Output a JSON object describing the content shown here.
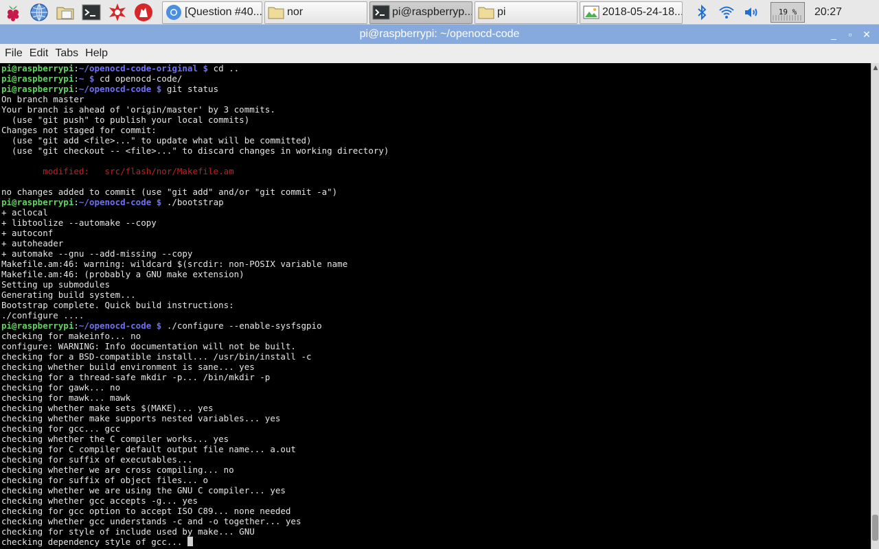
{
  "panel": {
    "tasks": [
      {
        "label": "[Question #40...",
        "icon": "chromium-icon"
      },
      {
        "label": "nor",
        "icon": "folder-icon"
      },
      {
        "label": "pi@raspberryp...",
        "icon": "terminal-icon"
      },
      {
        "label": "pi",
        "icon": "folder-icon"
      },
      {
        "label": "2018-05-24-18...",
        "icon": "image-icon"
      }
    ],
    "cpu": "19 %",
    "clock": "20:27"
  },
  "window": {
    "title": "pi@raspberrypi: ~/openocd-code",
    "minimize": "_",
    "maximize": "▫",
    "close": "✕"
  },
  "menu": [
    "File",
    "Edit",
    "Tabs",
    "Help"
  ],
  "colors": {
    "prompt_user": "#5fd65f",
    "prompt_path": "#6f6ff8",
    "modified": "#c02020",
    "titlebar": "#87aade"
  },
  "terminal": {
    "lines": [
      {
        "user": "pi@raspberrypi",
        "path": "~/openocd-code-original $",
        "cmd": " cd .."
      },
      {
        "user": "pi@raspberrypi",
        "path": "~ $",
        "cmd": " cd openocd-code/"
      },
      {
        "user": "pi@raspberrypi",
        "path": "~/openocd-code $",
        "cmd": " git status"
      },
      {
        "text": "On branch master"
      },
      {
        "text": "Your branch is ahead of 'origin/master' by 3 commits."
      },
      {
        "text": "  (use \"git push\" to publish your local commits)"
      },
      {
        "text": "Changes not staged for commit:"
      },
      {
        "text": "  (use \"git add <file>...\" to update what will be committed)"
      },
      {
        "text": "  (use \"git checkout -- <file>...\" to discard changes in working directory)"
      },
      {
        "text": ""
      },
      {
        "modified": "        modified:   src/flash/nor/Makefile.am"
      },
      {
        "text": ""
      },
      {
        "text": "no changes added to commit (use \"git add\" and/or \"git commit -a\")"
      },
      {
        "user": "pi@raspberrypi",
        "path": "~/openocd-code $",
        "cmd": " ./bootstrap"
      },
      {
        "text": "+ aclocal"
      },
      {
        "text": "+ libtoolize --automake --copy"
      },
      {
        "text": "+ autoconf"
      },
      {
        "text": "+ autoheader"
      },
      {
        "text": "+ automake --gnu --add-missing --copy"
      },
      {
        "text": "Makefile.am:46: warning: wildcard $(srcdir: non-POSIX variable name"
      },
      {
        "text": "Makefile.am:46: (probably a GNU make extension)"
      },
      {
        "text": "Setting up submodules"
      },
      {
        "text": "Generating build system..."
      },
      {
        "text": "Bootstrap complete. Quick build instructions:"
      },
      {
        "text": "./configure ...."
      },
      {
        "user": "pi@raspberrypi",
        "path": "~/openocd-code $",
        "cmd": " ./configure --enable-sysfsgpio"
      },
      {
        "text": "checking for makeinfo... no"
      },
      {
        "text": "configure: WARNING: Info documentation will not be built."
      },
      {
        "text": "checking for a BSD-compatible install... /usr/bin/install -c"
      },
      {
        "text": "checking whether build environment is sane... yes"
      },
      {
        "text": "checking for a thread-safe mkdir -p... /bin/mkdir -p"
      },
      {
        "text": "checking for gawk... no"
      },
      {
        "text": "checking for mawk... mawk"
      },
      {
        "text": "checking whether make sets $(MAKE)... yes"
      },
      {
        "text": "checking whether make supports nested variables... yes"
      },
      {
        "text": "checking for gcc... gcc"
      },
      {
        "text": "checking whether the C compiler works... yes"
      },
      {
        "text": "checking for C compiler default output file name... a.out"
      },
      {
        "text": "checking for suffix of executables..."
      },
      {
        "text": "checking whether we are cross compiling... no"
      },
      {
        "text": "checking for suffix of object files... o"
      },
      {
        "text": "checking whether we are using the GNU C compiler... yes"
      },
      {
        "text": "checking whether gcc accepts -g... yes"
      },
      {
        "text": "checking for gcc option to accept ISO C89... none needed"
      },
      {
        "text": "checking whether gcc understands -c and -o together... yes"
      },
      {
        "text": "checking for style of include used by make... GNU"
      },
      {
        "text": "checking dependency style of gcc... ",
        "cursor": true
      }
    ]
  }
}
